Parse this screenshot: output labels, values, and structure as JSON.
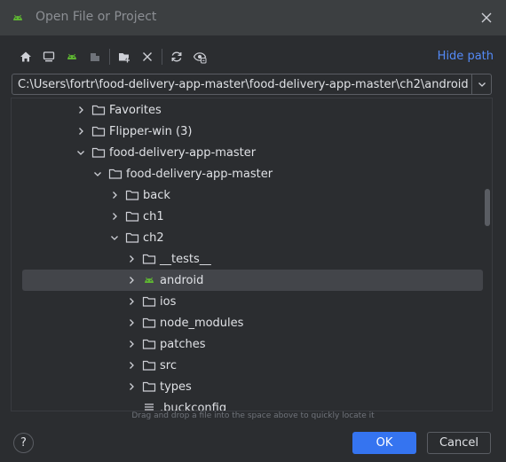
{
  "dialog": {
    "title": "Open File or Project",
    "hide_path": "Hide path",
    "path_value": "C:\\Users\\fortr\\food-delivery-app-master\\food-delivery-app-master\\ch2\\android",
    "hint": "Drag and drop a file into the space above to quickly locate it",
    "help_label": "?",
    "ok_label": "OK",
    "cancel_label": "Cancel"
  },
  "colors": {
    "background": "#2b2d30",
    "accent": "#3574f0",
    "link": "#548af7",
    "android_green": "#5fb832",
    "selection": "#43454a"
  },
  "toolbar": [
    {
      "icon": "home-icon"
    },
    {
      "icon": "desktop-icon"
    },
    {
      "icon": "android-project-icon"
    },
    {
      "icon": "module-icon"
    },
    {
      "icon": "new-folder-icon"
    },
    {
      "icon": "delete-icon"
    },
    {
      "icon": "refresh-icon"
    },
    {
      "icon": "show-hidden-icon"
    }
  ],
  "tree": {
    "rows": [
      {
        "label": "Favorites",
        "level": 0,
        "state": "collapsed",
        "icon": "folder-icon"
      },
      {
        "label": "Flipper-win (3)",
        "level": 0,
        "state": "collapsed",
        "icon": "folder-icon"
      },
      {
        "label": "food-delivery-app-master",
        "level": 0,
        "state": "expanded",
        "icon": "folder-icon"
      },
      {
        "label": "food-delivery-app-master",
        "level": 1,
        "state": "expanded",
        "icon": "folder-icon"
      },
      {
        "label": "back",
        "level": 2,
        "state": "collapsed",
        "icon": "folder-icon"
      },
      {
        "label": "ch1",
        "level": 2,
        "state": "collapsed",
        "icon": "folder-icon"
      },
      {
        "label": "ch2",
        "level": 2,
        "state": "expanded",
        "icon": "folder-icon"
      },
      {
        "label": "__tests__",
        "level": 3,
        "state": "collapsed",
        "icon": "folder-icon"
      },
      {
        "label": "android",
        "level": 3,
        "state": "collapsed",
        "icon": "android-icon",
        "selected": true
      },
      {
        "label": "ios",
        "level": 3,
        "state": "collapsed",
        "icon": "folder-icon"
      },
      {
        "label": "node_modules",
        "level": 3,
        "state": "collapsed",
        "icon": "folder-icon"
      },
      {
        "label": "patches",
        "level": 3,
        "state": "collapsed",
        "icon": "folder-icon"
      },
      {
        "label": "src",
        "level": 3,
        "state": "collapsed",
        "icon": "folder-icon"
      },
      {
        "label": "types",
        "level": 3,
        "state": "collapsed",
        "icon": "folder-icon"
      },
      {
        "label": ".buckconfig",
        "level": 3,
        "state": "leaf",
        "icon": "text-file-icon"
      }
    ]
  }
}
